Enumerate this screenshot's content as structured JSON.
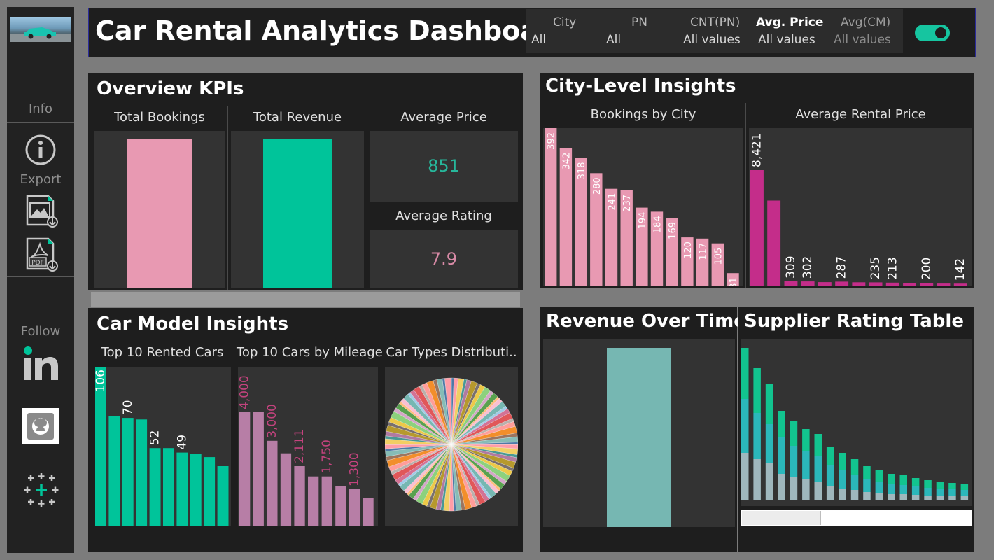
{
  "sidebar": {
    "info_label": "Info",
    "export_label": "Export",
    "follow_label": "Follow"
  },
  "header": {
    "title": "Car Rental Analytics Dashboard",
    "filters": [
      {
        "label": "City",
        "value": "All"
      },
      {
        "label": "PN",
        "value": "All"
      },
      {
        "label": "CNT(PN)",
        "value": "All values"
      },
      {
        "label": "Avg. Price",
        "value": "All values"
      },
      {
        "label": "Avg(CM)",
        "value": "All values"
      }
    ],
    "toggle_on": true
  },
  "overview": {
    "title": "Overview KPIs",
    "total_bookings_label": "Total Bookings",
    "total_revenue_label": "Total Revenue",
    "avg_price_label": "Average Price",
    "avg_price_value": "851",
    "avg_rating_label": "Average Rating",
    "avg_rating_value": "7.9"
  },
  "city": {
    "title": "City-Level Insights",
    "bookings_label": "Bookings by City",
    "avg_price_label": "Average Rental Price"
  },
  "car_model": {
    "title": "Car Model Insights",
    "top_rented_label": "Top 10 Rented Cars",
    "mileage_label": "Top 10 Cars by Mileage",
    "types_label": "Car Types Distributi.."
  },
  "revenue": {
    "title": "Revenue Over Time"
  },
  "supplier": {
    "title": "Supplier Rating Table"
  },
  "colors": {
    "pink": "#e899b2",
    "teal": "#00c49a",
    "magenta": "#c42d8a",
    "mauve": "#b77ea6",
    "revenue_teal": "#76b7b2"
  },
  "chart_data": [
    {
      "type": "bar",
      "title": "Bookings by City",
      "values": [
        392,
        342,
        318,
        280,
        241,
        237,
        194,
        184,
        169,
        120,
        117,
        105,
        31
      ],
      "labels": [
        "392",
        "342",
        "318",
        "280",
        "241",
        "237",
        "194",
        "184",
        "169",
        "120",
        "117",
        "105",
        "31"
      ]
    },
    {
      "type": "bar",
      "title": "Average Rental Price",
      "values": [
        8421,
        6200,
        309,
        302,
        250,
        287,
        240,
        235,
        213,
        190,
        200,
        150,
        142
      ],
      "labels": [
        "8,421",
        "",
        "309",
        "302",
        "",
        "287",
        "",
        "235",
        "213",
        "",
        "200",
        "",
        "142"
      ]
    },
    {
      "type": "bar",
      "title": "Top 10 Rented Cars",
      "values": [
        106,
        73,
        72,
        71,
        52,
        52,
        49,
        48,
        46,
        40
      ],
      "labels": [
        "106",
        "",
        "70",
        "",
        "52",
        "",
        "49",
        "",
        "",
        ""
      ]
    },
    {
      "type": "bar",
      "title": "Top 10 Cars by Mileage",
      "values": [
        4000,
        4000,
        3000,
        2560,
        2111,
        1750,
        1750,
        1400,
        1300,
        1000
      ],
      "labels": [
        "4,000",
        "",
        "3,000",
        "",
        "2,111",
        "",
        "1,750",
        "",
        "1,300",
        ""
      ]
    },
    {
      "type": "pie",
      "title": "Car Types Distributi..",
      "slices": 90
    },
    {
      "type": "bar",
      "title": "Revenue Over Time",
      "values": [
        1
      ]
    },
    {
      "type": "bar",
      "title": "Supplier Rating Table",
      "series": [
        {
          "values": [
            68,
            59,
            53,
            38,
            34,
            30,
            26,
            21,
            17,
            15,
            12,
            10,
            9,
            9,
            8,
            7,
            7,
            6,
            6
          ]
        },
        {
          "values": [
            77,
            66,
            56,
            52,
            44,
            40,
            38,
            30,
            27,
            22,
            18,
            16,
            14,
            13,
            12,
            11,
            10,
            10,
            9
          ]
        },
        {
          "values": [
            73,
            64,
            58,
            38,
            36,
            32,
            31,
            26,
            24,
            22,
            19,
            17,
            15,
            14,
            12,
            11,
            10,
            9,
            9
          ]
        }
      ]
    }
  ]
}
